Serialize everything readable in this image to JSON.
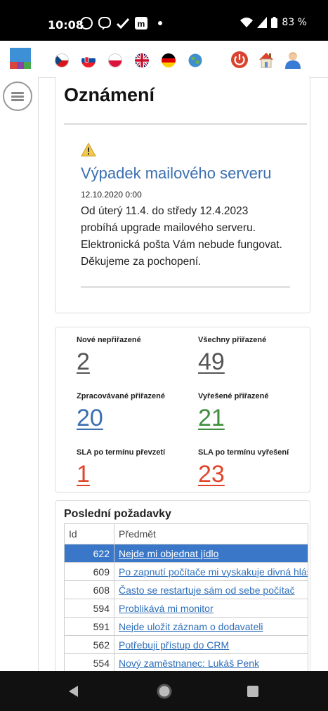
{
  "status": {
    "time": "10:08",
    "battery": "83 %"
  },
  "languages": [
    "czech-flag-icon",
    "slovak-flag-icon",
    "polish-flag-icon",
    "uk-flag-icon",
    "german-flag-icon",
    "globe-icon"
  ],
  "announcement": {
    "heading": "Oznámení",
    "title": "Výpadek mailového serveru",
    "date": "12.10.2020 0:00",
    "body": "Od úterý 11.4. do středy 12.4.2023\nprobíhá upgrade mailového serveru.\nElektronická pošta Vám nebude fungovat.\nDěkujeme za pochopení."
  },
  "stats": [
    {
      "label": "Nové nepřiřazené",
      "value": "2",
      "color": "#555555"
    },
    {
      "label": "Všechny přiřazené",
      "value": "49",
      "color": "#555555"
    },
    {
      "label": "Zpracovávané přiřazené",
      "value": "20",
      "color": "#3a6fb0"
    },
    {
      "label": "Vyřešené přiřazené",
      "value": "21",
      "color": "#3e8e3e"
    },
    {
      "label": "SLA po termínu převzetí",
      "value": "1",
      "color": "#e0452b"
    },
    {
      "label": "SLA po termínu vyřešení",
      "value": "23",
      "color": "#e0452b"
    }
  ],
  "recent": {
    "title": "Poslední požadavky",
    "columns": [
      "Id",
      "Předmět"
    ],
    "rows": [
      {
        "id": "622",
        "subject": "Nejde mi objednat jídlo"
      },
      {
        "id": "609",
        "subject": "Po zapnutí počítače mi vyskakuje divná hláška"
      },
      {
        "id": "608",
        "subject": "Často se restartuje sám od sebe počítač"
      },
      {
        "id": "594",
        "subject": "Problikává mi monitor"
      },
      {
        "id": "591",
        "subject": "Nejde uložit záznam o dodavateli"
      },
      {
        "id": "562",
        "subject": "Potřebuji přístup do CRM"
      },
      {
        "id": "554",
        "subject": "Nový zaměstnanec: Lukáš Penk"
      }
    ]
  }
}
